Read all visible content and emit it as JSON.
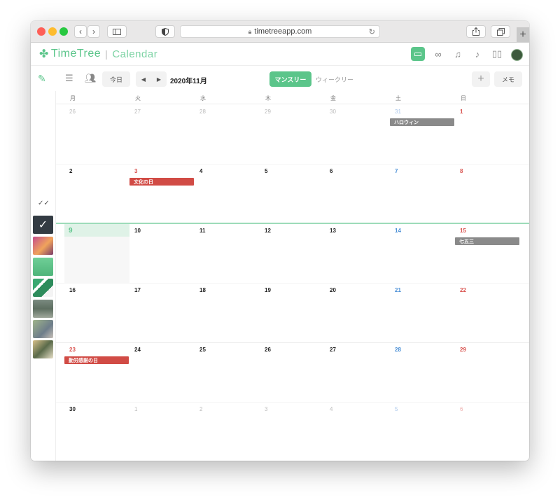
{
  "browser": {
    "url": "timetreeapp.com",
    "back_icon": "chevron-left-icon",
    "forward_icon": "chevron-right-icon",
    "new_tab_label": "+"
  },
  "app": {
    "logo_text": "TimeTree",
    "logo_separator": "|",
    "logo_sub": "Calendar"
  },
  "toolbar": {
    "today_label": "今日",
    "prev_arrow": "◀",
    "next_arrow": "▶",
    "month_title": "2020年11月",
    "tab_monthly": "マンスリー",
    "tab_weekly": "ウィークリー",
    "add_label": "+",
    "memo_label": "メモ"
  },
  "colors": {
    "accent": "#5bc58a",
    "holiday_red": "#d9534f",
    "saturday_blue": "#4a8fd6",
    "event_gray": "#8a8a8a",
    "event_red": "#d14b45"
  },
  "weekdays": [
    "月",
    "火",
    "水",
    "木",
    "金",
    "土",
    "日"
  ],
  "weeks": [
    [
      "26",
      "27",
      "28",
      "29",
      "30",
      "31",
      "1"
    ],
    [
      "2",
      "3",
      "4",
      "5",
      "6",
      "7",
      "8"
    ],
    [
      "9",
      "10",
      "11",
      "12",
      "13",
      "14",
      "15"
    ],
    [
      "16",
      "17",
      "18",
      "19",
      "20",
      "21",
      "22"
    ],
    [
      "23",
      "24",
      "25",
      "26",
      "27",
      "28",
      "29"
    ],
    [
      "30",
      "1",
      "2",
      "3",
      "4",
      "5",
      "6"
    ]
  ],
  "events": {
    "halloween": "ハロウィン",
    "culture_day": "文化の日",
    "shichigosan": "七五三",
    "labor_thanksgiving": "勤労感謝の日"
  }
}
